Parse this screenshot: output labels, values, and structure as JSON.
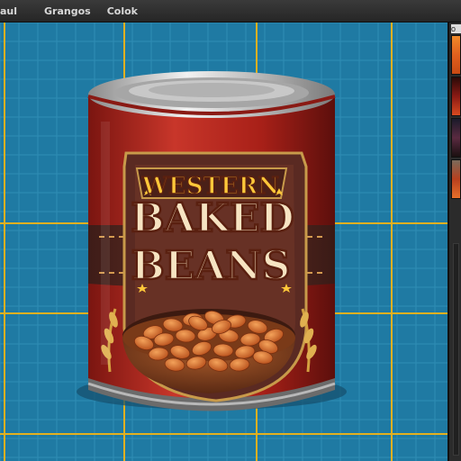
{
  "menu": {
    "items": [
      {
        "label": "aul"
      },
      {
        "label": "Grangos"
      },
      {
        "label": "Colok"
      }
    ]
  },
  "panel": {
    "label": "o",
    "swatches": [
      {
        "name": "gradient-orange",
        "color": "#e0601e"
      },
      {
        "name": "gradient-red",
        "color": "#8a1a14"
      },
      {
        "name": "gradient-purple",
        "color": "#5a2a40"
      },
      {
        "name": "gradient-sunset",
        "color": "#b8401e"
      }
    ]
  },
  "can": {
    "label_line1": "WESTERN",
    "label_line2": "BAKED",
    "label_line3": "BEANS"
  },
  "colors": {
    "canvas_bg": "#1f7aa3",
    "grid_fine": "#2f8db5",
    "grid_guide": "#e2b020",
    "can_red": "#b82822",
    "can_brown": "#5a2a22",
    "label_cream": "#f6e4c2",
    "label_gold": "#ffc83a"
  }
}
